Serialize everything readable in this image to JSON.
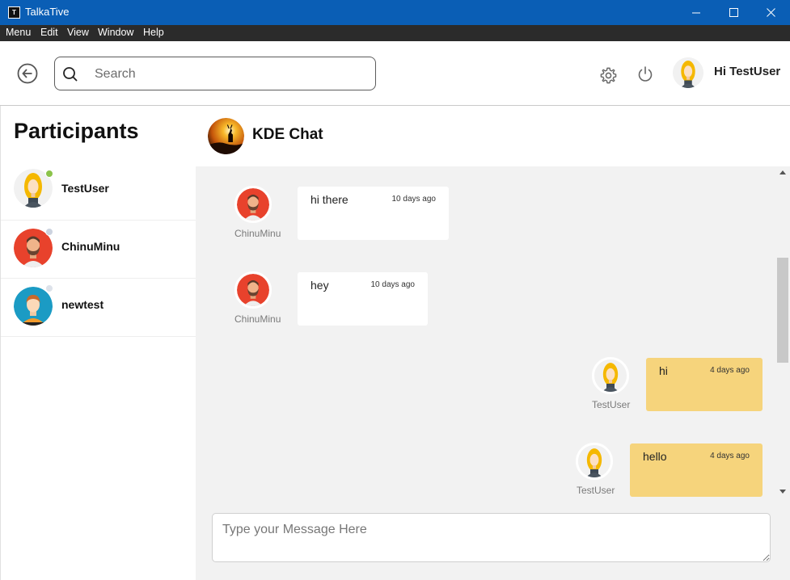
{
  "window": {
    "title": "TalkaTive",
    "icon_glyph": "T",
    "controls": [
      "minimize-icon",
      "maximize-icon",
      "close-icon"
    ]
  },
  "menubar": {
    "items": [
      "Menu",
      "Edit",
      "View",
      "Window",
      "Help"
    ]
  },
  "header": {
    "back_icon": "arrow-left-circle-icon",
    "search_placeholder": "Search",
    "search_value": "",
    "settings_icon": "gear-icon",
    "power_icon": "power-icon",
    "greeting": "Hi TestUser"
  },
  "sidebar": {
    "title": "Participants",
    "participants": [
      {
        "name": "TestUser",
        "status": "online",
        "status_color": "#8bc34a"
      },
      {
        "name": "ChinuMinu",
        "status": "offline",
        "status_color": "#ccd3df"
      },
      {
        "name": "newtest",
        "status": "offline",
        "status_color": "#dde2ea"
      }
    ]
  },
  "chat": {
    "name": "KDE Chat",
    "messages": [
      {
        "sender": "ChinuMinu",
        "text": "hi there",
        "time": "10 days ago",
        "direction": "in"
      },
      {
        "sender": "ChinuMinu",
        "text": "hey",
        "time": "10 days ago",
        "direction": "in"
      },
      {
        "sender": "TestUser",
        "text": "hi",
        "time": "4 days ago",
        "direction": "out"
      },
      {
        "sender": "TestUser",
        "text": "hello",
        "time": "4 days ago",
        "direction": "out"
      }
    ],
    "composer_placeholder": "Type your Message Here",
    "composer_value": ""
  },
  "colors": {
    "titlebar": "#0a5eb5",
    "menubar": "#2b2b2b",
    "outgoing_bubble": "#f6d47c",
    "incoming_bubble": "#ffffff",
    "chat_background": "#f2f2f2"
  }
}
